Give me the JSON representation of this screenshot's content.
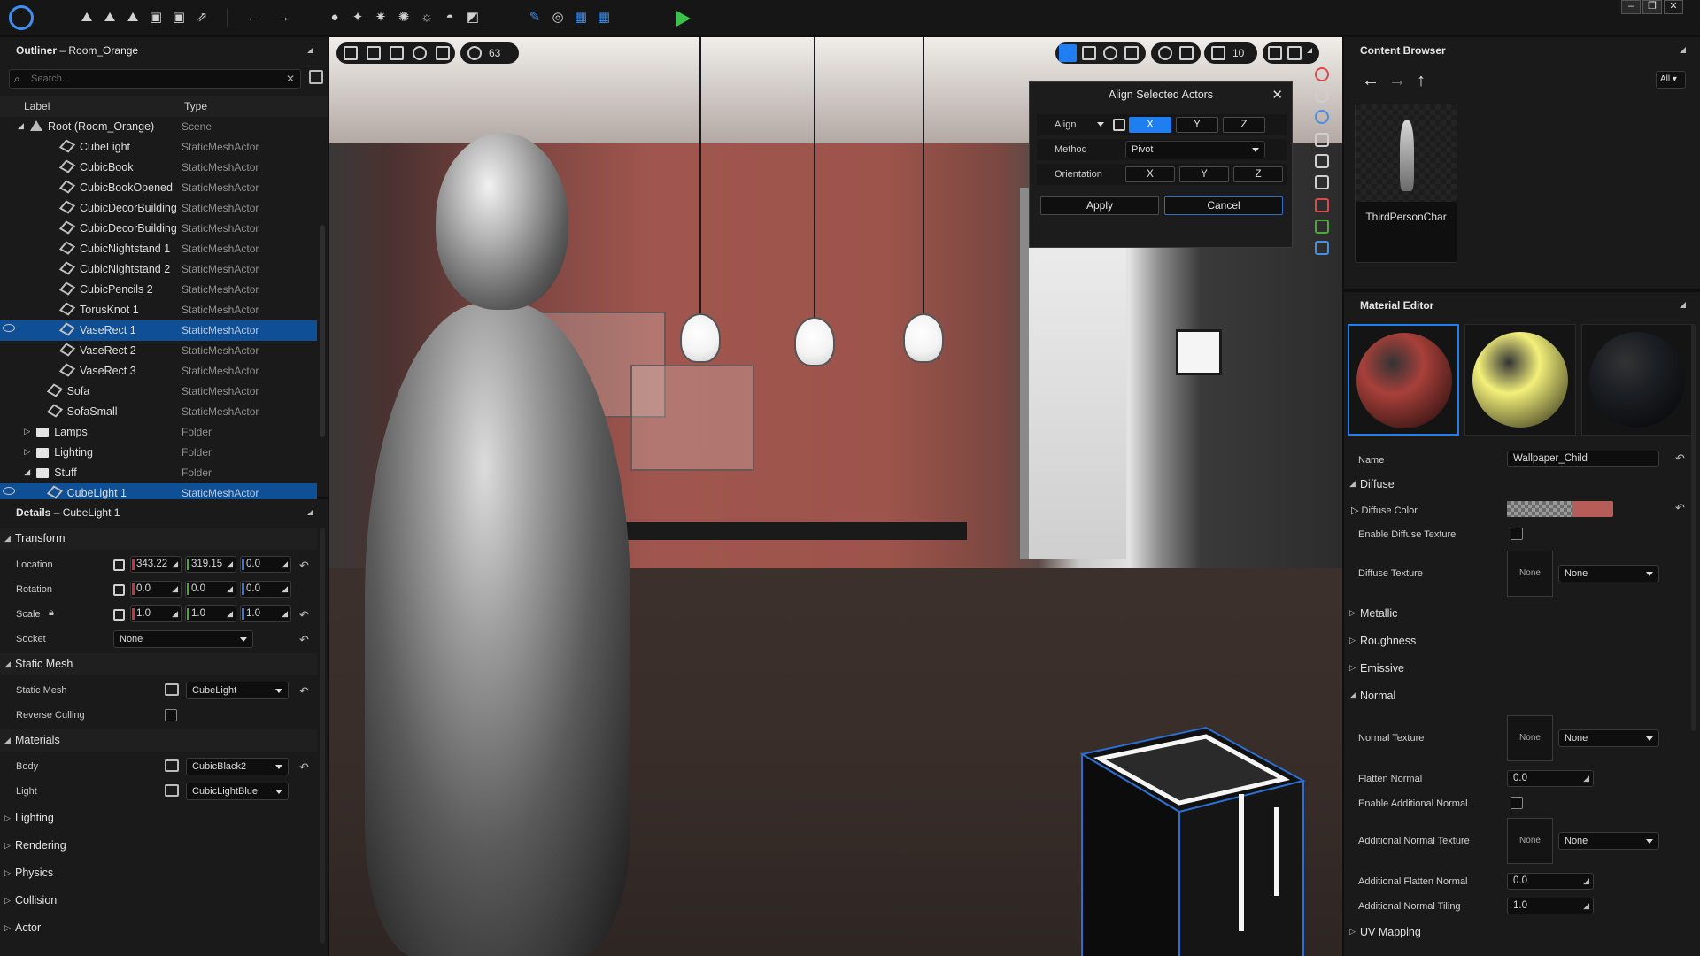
{
  "outliner": {
    "title": "Outliner",
    "level": "Room_Orange",
    "search_placeholder": "Search...",
    "col_label": "Label",
    "col_type": "Type",
    "rows": [
      {
        "label": "Root (Room_Orange)",
        "type": "Scene"
      },
      {
        "label": "CubeLight",
        "type": "StaticMeshActor"
      },
      {
        "label": "CubicBook",
        "type": "StaticMeshActor"
      },
      {
        "label": "CubicBookOpened",
        "type": "StaticMeshActor"
      },
      {
        "label": "CubicDecorBuilding",
        "type": "StaticMeshActor"
      },
      {
        "label": "CubicDecorBuilding",
        "type": "StaticMeshActor"
      },
      {
        "label": "CubicNightstand 1",
        "type": "StaticMeshActor"
      },
      {
        "label": "CubicNightstand 2",
        "type": "StaticMeshActor"
      },
      {
        "label": "CubicPencils 2",
        "type": "StaticMeshActor"
      },
      {
        "label": "TorusKnot 1",
        "type": "StaticMeshActor"
      },
      {
        "label": "VaseRect 1",
        "type": "StaticMeshActor"
      },
      {
        "label": "VaseRect 2",
        "type": "StaticMeshActor"
      },
      {
        "label": "VaseRect 3",
        "type": "StaticMeshActor"
      },
      {
        "label": "Sofa",
        "type": "StaticMeshActor"
      },
      {
        "label": "SofaSmall",
        "type": "StaticMeshActor"
      },
      {
        "label": "Lamps",
        "type": "Folder"
      },
      {
        "label": "Lighting",
        "type": "Folder"
      },
      {
        "label": "Stuff",
        "type": "Folder"
      },
      {
        "label": "CubeLight 1",
        "type": "StaticMeshActor"
      }
    ]
  },
  "details": {
    "title": "Details",
    "object": "CubeLight 1",
    "sec_transform": "Transform",
    "location_label": "Location",
    "location": [
      "343.22",
      "319.15",
      "0.0"
    ],
    "rotation_label": "Rotation",
    "rotation": [
      "0.0",
      "0.0",
      "0.0"
    ],
    "scale_label": "Scale",
    "scale": [
      "1.0",
      "1.0",
      "1.0"
    ],
    "socket_label": "Socket",
    "socket_value": "None",
    "sec_static_mesh": "Static Mesh",
    "static_mesh_label": "Static Mesh",
    "static_mesh_value": "CubeLight",
    "reverse_culling_label": "Reverse Culling",
    "sec_materials": "Materials",
    "body_label": "Body",
    "body_value": "CubicBlack2",
    "light_label": "Light",
    "light_value": "CubicLightBlue",
    "sec_lighting": "Lighting",
    "sec_rendering": "Rendering",
    "sec_physics": "Physics",
    "sec_collision": "Collision",
    "sec_actor": "Actor"
  },
  "viewport": {
    "fov_value": "63",
    "grid_value": "10"
  },
  "align_dialog": {
    "title": "Align Selected Actors",
    "align_label": "Align",
    "x": "X",
    "y": "Y",
    "z": "Z",
    "method_label": "Method",
    "method_value": "Pivot",
    "orientation_label": "Orientation",
    "apply": "Apply",
    "cancel": "Cancel"
  },
  "content_browser": {
    "title": "Content Browser",
    "filter": "All",
    "asset_name": "ThirdPersonChar"
  },
  "material_editor": {
    "title": "Material Editor",
    "name_label": "Name",
    "name_value": "Wallpaper_Child",
    "sec_diffuse": "Diffuse",
    "diffuse_color_label": "Diffuse Color",
    "enable_diffuse_texture_label": "Enable Diffuse Texture",
    "diffuse_texture_label": "Diffuse Texture",
    "none": "None",
    "sec_metallic": "Metallic",
    "sec_roughness": "Roughness",
    "sec_emissive": "Emissive",
    "sec_normal": "Normal",
    "normal_texture_label": "Normal Texture",
    "flatten_normal_label": "Flatten Normal",
    "flatten_normal_value": "0.0",
    "enable_additional_normal_label": "Enable Additional Normal",
    "additional_normal_texture_label": "Additional Normal Texture",
    "additional_flatten_normal_label": "Additional Flatten Normal",
    "additional_flatten_normal_value": "0.0",
    "additional_normal_tiling_label": "Additional Normal Tiling",
    "additional_normal_tiling_value": "1.0",
    "sec_uv_mapping": "UV Mapping",
    "ball_colors": [
      "#a8403a",
      "#f3f07a",
      "#1c1f24"
    ]
  },
  "colors": {
    "accent": "#1f7ff0",
    "selection": "#0f4f96",
    "play": "#3bc24a"
  }
}
